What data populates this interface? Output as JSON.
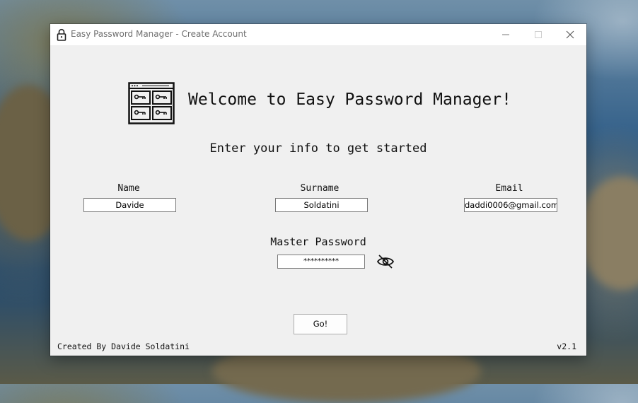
{
  "window": {
    "title": "Easy Password Manager - Create Account",
    "icons": {
      "app": "lock-icon",
      "minimize": "minimize-icon",
      "maximize": "maximize-icon",
      "close": "close-icon"
    }
  },
  "header": {
    "logo_icon": "password-manager-logo-icon",
    "welcome": "Welcome to Easy Password Manager!"
  },
  "form": {
    "subtitle": "Enter your info to get started",
    "name": {
      "label": "Name",
      "value": "Davide"
    },
    "surname": {
      "label": "Surname",
      "value": "Soldatini"
    },
    "email": {
      "label": "Email",
      "value": "daddi0006@gmail.com"
    },
    "master_password": {
      "label": "Master Password",
      "value": "**********",
      "toggle_icon": "eye-slash-icon"
    },
    "submit_label": "Go!"
  },
  "footer": {
    "credit": "Created By Davide Soldatini",
    "version": "v2.1"
  }
}
